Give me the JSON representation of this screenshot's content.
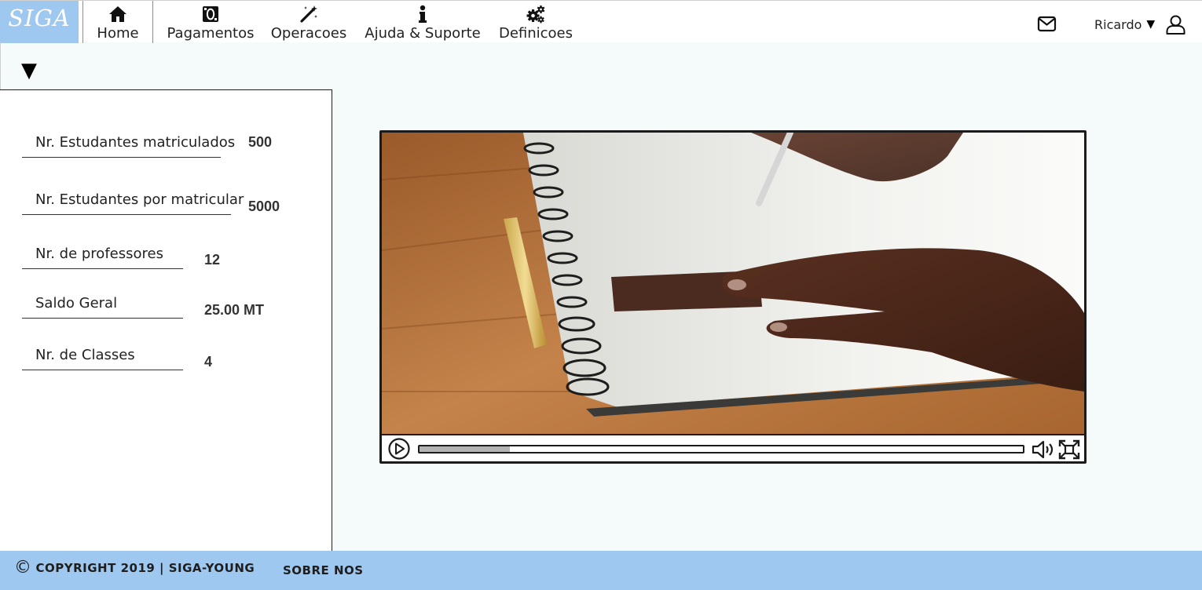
{
  "app": {
    "logo": "SIGA"
  },
  "nav": {
    "items": [
      {
        "label": "Home",
        "icon": "home-icon",
        "active": true
      },
      {
        "label": "Pagamentos",
        "icon": "money-icon"
      },
      {
        "label": "Operacoes",
        "icon": "magic-wand-icon"
      },
      {
        "label": "Ajuda & Suporte",
        "icon": "info-icon"
      },
      {
        "label": "Definicoes",
        "icon": "gears-icon"
      }
    ]
  },
  "user": {
    "name": "Ricardo",
    "caret": "▼"
  },
  "panel": {
    "toggle": "▼",
    "stats": [
      {
        "label": "Nr. Estudantes matriculados",
        "value": "500"
      },
      {
        "label": "Nr. Estudantes por matricular",
        "value": "5000"
      },
      {
        "label": "Nr. de professores",
        "value": "12"
      },
      {
        "label": "Saldo Geral",
        "value": "25.00 MT"
      },
      {
        "label": "Nr. de Classes",
        "value": "4"
      }
    ]
  },
  "video": {
    "progress": 0.15
  },
  "footer": {
    "copyright_symbol": "©",
    "copyright": "COPYRIGHT 2019 | SIGA-YOUNG",
    "about": "SOBRE NOS"
  },
  "colors": {
    "brand": "#9ec8f0",
    "background": "#f5fafa",
    "panel": "#ffffff",
    "text": "#1e1e1e"
  }
}
